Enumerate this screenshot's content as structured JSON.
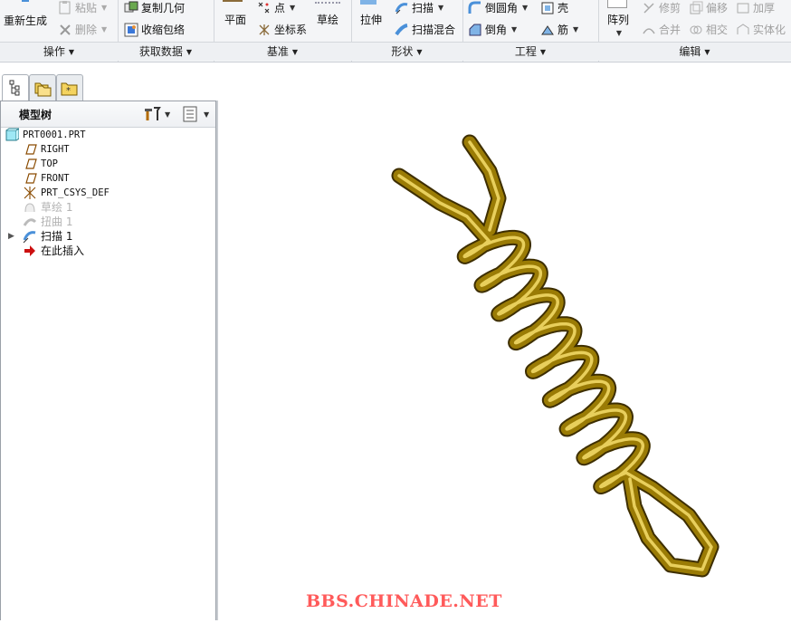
{
  "ribbon": {
    "operations": {
      "label": "操作",
      "regenerate": "重新生成",
      "paste": "粘贴",
      "delete": "删除"
    },
    "get_data": {
      "label": "获取数据",
      "copy_geometry": "复制几何",
      "shrinkwrap": "收缩包络"
    },
    "datum": {
      "label": "基准",
      "plane": "平面",
      "point": "点",
      "csys": "坐标系",
      "sketch": "草绘"
    },
    "shapes": {
      "label": "形状",
      "extrude": "拉伸",
      "sweep": "扫描",
      "swept_blend": "扫描混合"
    },
    "engineering": {
      "label": "工程",
      "round": "倒圆角",
      "chamfer": "倒角",
      "shell": "壳",
      "rib": "筋"
    },
    "editing": {
      "label": "编辑",
      "pattern": "阵列",
      "trim": "修剪",
      "offset": "偏移",
      "thicken": "加厚",
      "merge": "合并",
      "intersect": "相交",
      "solidify": "实体化"
    }
  },
  "model_tree": {
    "title": "模型树",
    "items": [
      {
        "label": "PRT0001.PRT"
      },
      {
        "label": "RIGHT"
      },
      {
        "label": "TOP"
      },
      {
        "label": "FRONT"
      },
      {
        "label": "PRT_CSYS_DEF"
      },
      {
        "label": "草绘 1"
      },
      {
        "label": "扭曲 1"
      },
      {
        "label": "扫描 1"
      },
      {
        "label": "在此插入"
      }
    ]
  },
  "watermark": "BBS.CHINADE.NET",
  "colors": {
    "spring": "#9a7b05",
    "watermark": "#ff5a5a",
    "insert_arrow": "#cc1010"
  }
}
